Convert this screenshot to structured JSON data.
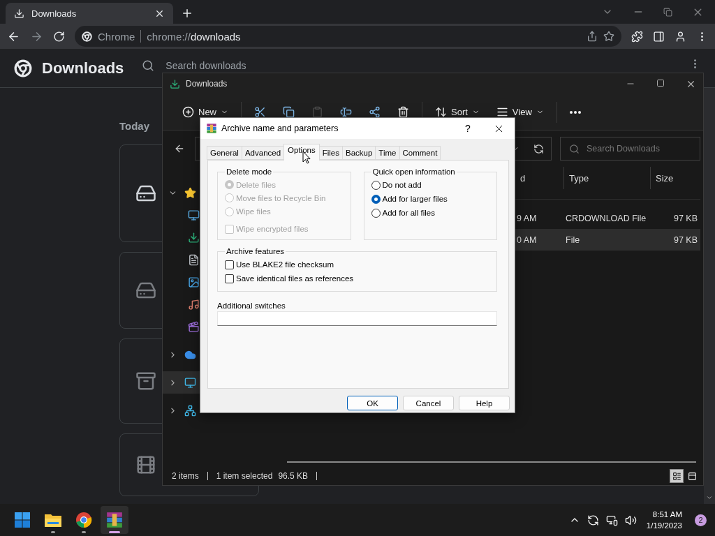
{
  "browser": {
    "tabs": [
      {
        "title": "Downloads",
        "selected": true
      }
    ],
    "omnibox": {
      "site": "Chrome",
      "scheme": "chrome://",
      "path": "downloads"
    }
  },
  "downloads_page": {
    "title": "Downloads",
    "search": {
      "placeholder": "Search downloads"
    },
    "date_heading": "Today",
    "items": [
      {
        "kind": "drive"
      },
      {
        "kind": "drive"
      },
      {
        "kind": "archive"
      },
      {
        "kind": "video"
      }
    ]
  },
  "explorer": {
    "title": "Downloads",
    "commands": [
      {
        "kind": "new",
        "label": "New",
        "disabled": false
      },
      {
        "kind": "cut",
        "disabled": false
      },
      {
        "kind": "copy",
        "disabled": false
      },
      {
        "kind": "paste",
        "disabled": true
      },
      {
        "kind": "rename",
        "disabled": false
      },
      {
        "kind": "share",
        "disabled": false
      },
      {
        "kind": "delete",
        "disabled": false
      },
      {
        "kind": "sort",
        "label": "Sort",
        "disabled": false
      },
      {
        "kind": "view",
        "label": "View",
        "disabled": false
      },
      {
        "kind": "more",
        "disabled": false
      }
    ],
    "search": {
      "placeholder": "Search Downloads"
    },
    "nav": [
      {
        "kind": "quick-access",
        "expanded": true,
        "selected": false,
        "children": [
          {
            "kind": "desktop"
          },
          {
            "kind": "downloads"
          },
          {
            "kind": "documents"
          },
          {
            "kind": "pictures"
          },
          {
            "kind": "music"
          },
          {
            "kind": "videos"
          }
        ]
      },
      {
        "kind": "onedrive",
        "expanded": false,
        "selected": false
      },
      {
        "kind": "this-pc",
        "expanded": false,
        "selected": true
      },
      {
        "kind": "network",
        "expanded": false,
        "selected": false
      }
    ],
    "columns": [
      "d",
      "Type",
      "Size"
    ],
    "rows": [
      {
        "cells": [
          "9 AM",
          "CRDOWNLOAD File",
          "97 KB"
        ],
        "selected": false
      },
      {
        "cells": [
          "0 AM",
          "File",
          "97 KB"
        ],
        "selected": true
      }
    ],
    "status": {
      "items": "2 items",
      "selection": "1 item selected",
      "size": "96.5 KB"
    },
    "views": [
      {
        "kind": "details",
        "selected": true
      },
      {
        "kind": "tiles",
        "selected": false
      }
    ]
  },
  "dialog": {
    "title": "Archive name and parameters",
    "help": "?",
    "tabs": [
      {
        "label": "General",
        "selected": false
      },
      {
        "label": "Advanced",
        "selected": false
      },
      {
        "label": "Options",
        "selected": true
      },
      {
        "label": "Files",
        "selected": false
      },
      {
        "label": "Backup",
        "selected": false
      },
      {
        "label": "Time",
        "selected": false
      },
      {
        "label": "Comment",
        "selected": false
      }
    ],
    "delete_mode": {
      "title": "Delete mode",
      "disabled": true,
      "options": [
        {
          "label": "Delete files",
          "selected": true
        },
        {
          "label": "Move files to Recycle Bin",
          "selected": false
        },
        {
          "label": "Wipe files",
          "selected": false
        }
      ],
      "wipe_encrypted": {
        "label": "Wipe encrypted files",
        "checked": false
      }
    },
    "quick_open": {
      "title": "Quick open information",
      "options": [
        {
          "label": "Do not add",
          "selected": false
        },
        {
          "label": "Add for larger files",
          "selected": true
        },
        {
          "label": "Add for all files",
          "selected": false
        }
      ]
    },
    "archive_features": {
      "title": "Archive features",
      "options": [
        {
          "label": "Use BLAKE2 file checksum",
          "checked": false
        },
        {
          "label": "Save identical files as references",
          "checked": false
        }
      ]
    },
    "switches": {
      "label": "Additional switches"
    },
    "buttons": [
      {
        "label": "OK",
        "default": true
      },
      {
        "label": "Cancel",
        "default": false
      },
      {
        "label": "Help",
        "default": false
      }
    ]
  },
  "taskbar": {
    "apps": [
      {
        "kind": "start",
        "active": false,
        "running": false
      },
      {
        "kind": "explorer",
        "active": false,
        "running": true
      },
      {
        "kind": "chrome",
        "active": false,
        "running": true
      },
      {
        "kind": "winrar",
        "active": true,
        "running": true
      }
    ],
    "time": "8:51 AM",
    "date": "1/19/2023",
    "notifications": "2"
  }
}
